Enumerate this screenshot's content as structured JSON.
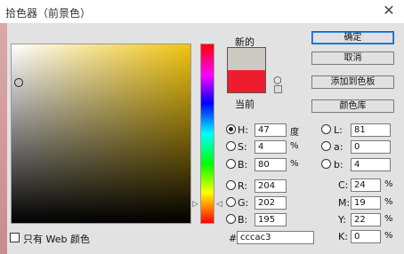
{
  "window": {
    "title": "拾色器（前景色）",
    "close_glyph": "✕"
  },
  "swatch": {
    "new_label": "新的",
    "current_label": "当前",
    "new_color": "#cccac3",
    "current_color": "#ee1d2e"
  },
  "buttons": {
    "ok": "确定",
    "cancel": "取消",
    "add_swatch": "添加到色板",
    "libraries": "颜色库"
  },
  "hsb": [
    {
      "label": "H:",
      "value": "47",
      "unit": "度",
      "selected": true
    },
    {
      "label": "S:",
      "value": "4",
      "unit": "%",
      "selected": false
    },
    {
      "label": "B:",
      "value": "80",
      "unit": "%",
      "selected": false
    }
  ],
  "rgb": [
    {
      "label": "R:",
      "value": "204"
    },
    {
      "label": "G:",
      "value": "202"
    },
    {
      "label": "B:",
      "value": "195"
    }
  ],
  "lab": [
    {
      "label": "L:",
      "value": "81"
    },
    {
      "label": "a:",
      "value": "0"
    },
    {
      "label": "b:",
      "value": "4"
    }
  ],
  "cmyk": [
    {
      "label": "C:",
      "value": "24",
      "unit": "%"
    },
    {
      "label": "M:",
      "value": "19",
      "unit": "%"
    },
    {
      "label": "Y:",
      "value": "22",
      "unit": "%"
    },
    {
      "label": "K:",
      "value": "0",
      "unit": "%"
    }
  ],
  "hex": {
    "label": "#",
    "value": "cccac3"
  },
  "web_only": {
    "label": "只有 Web 颜色",
    "checked": false
  },
  "colors": {
    "field_hue": "#f1c40f",
    "accent": "#0a64c8"
  }
}
